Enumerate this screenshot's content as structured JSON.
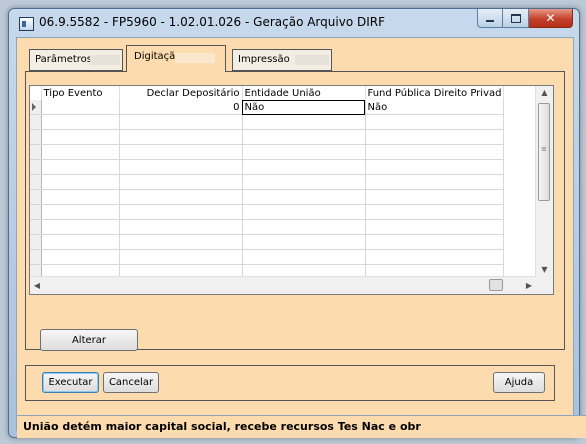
{
  "window": {
    "title": "06.9.5582 - FP5960 - 1.02.01.026 - Geração Arquivo DIRF",
    "controls": {
      "minimize": "minimize-icon",
      "maximize": "maximize-icon",
      "close": "close-icon"
    }
  },
  "tabs": [
    {
      "label": "Parâmetros",
      "active": false
    },
    {
      "label": "Digitação",
      "active": true
    },
    {
      "label": "Impressão",
      "active": false
    }
  ],
  "grid": {
    "columns": [
      "Tipo Evento",
      "Declar Depositário",
      "Entidade União",
      "Fund Pública Direito Privad"
    ],
    "rows": [
      [
        "",
        "0",
        "Não",
        "Não"
      ],
      [
        "",
        "",
        "",
        ""
      ],
      [
        "",
        "",
        "",
        ""
      ],
      [
        "",
        "",
        "",
        ""
      ],
      [
        "",
        "",
        "",
        ""
      ],
      [
        "",
        "",
        "",
        ""
      ],
      [
        "",
        "",
        "",
        ""
      ],
      [
        "",
        "",
        "",
        ""
      ],
      [
        "",
        "",
        "",
        ""
      ],
      [
        "",
        "",
        "",
        ""
      ],
      [
        "",
        "",
        "",
        ""
      ],
      [
        "",
        "",
        "",
        ""
      ]
    ]
  },
  "buttons": {
    "alterar": "Alterar",
    "executar": "Executar",
    "cancelar": "Cancelar",
    "ajuda": "Ajuda"
  },
  "status": {
    "text": "União detém maior capital social, recebe recursos Tes Nac e obr"
  }
}
